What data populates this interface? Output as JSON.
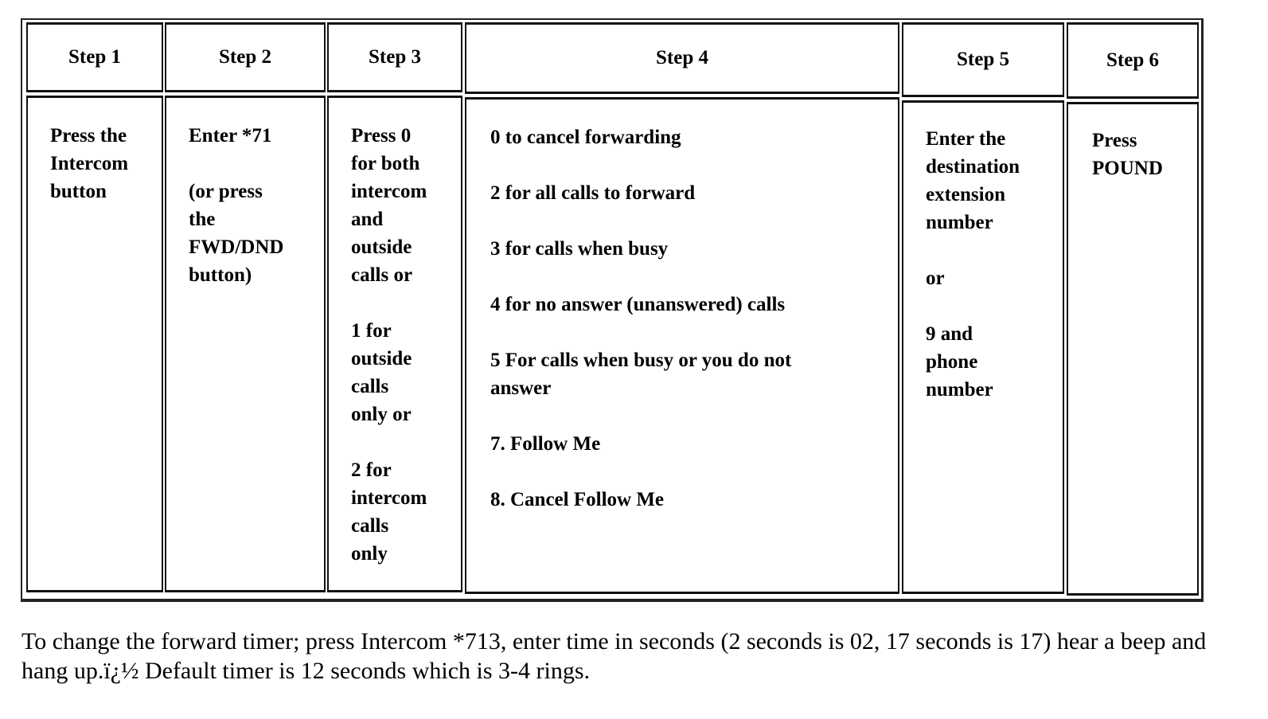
{
  "table": {
    "headers": [
      "Step 1",
      "Step 2",
      "Step 3",
      "Step 4",
      "Step 5",
      "Step 6"
    ],
    "step1": [
      "Press the",
      "Intercom",
      "button"
    ],
    "step2": {
      "line1": "Enter *71",
      "paren": [
        "(or press",
        "the",
        "FWD/DND",
        "button)"
      ]
    },
    "step3": {
      "group1": [
        "Press 0",
        "for both",
        "intercom",
        "and",
        "outside",
        "calls or"
      ],
      "group2": [
        "1 for",
        "outside",
        "calls",
        "only or"
      ],
      "group3": [
        "2 for",
        "intercom",
        "calls",
        "only"
      ]
    },
    "step4": [
      "0 to cancel forwarding",
      "2 for all calls to forward",
      "3 for calls when busy",
      "4 for no answer (unanswered) calls",
      "5 For calls when busy or you do not answer",
      "7. Follow Me",
      "8. Cancel Follow Me"
    ],
    "step5": {
      "group1": [
        "Enter the",
        "destination",
        "extension",
        "number"
      ],
      "or": "or",
      "group2": [
        "9 and",
        "phone",
        "number"
      ]
    },
    "step6": [
      "Press",
      "POUND"
    ]
  },
  "note": "To change the forward timer; press Intercom *713, enter time in seconds (2 seconds is 02, 17 seconds is 17) hear a beep and hang up.ï¿½ Default timer is 12 seconds which is 3-4 rings."
}
